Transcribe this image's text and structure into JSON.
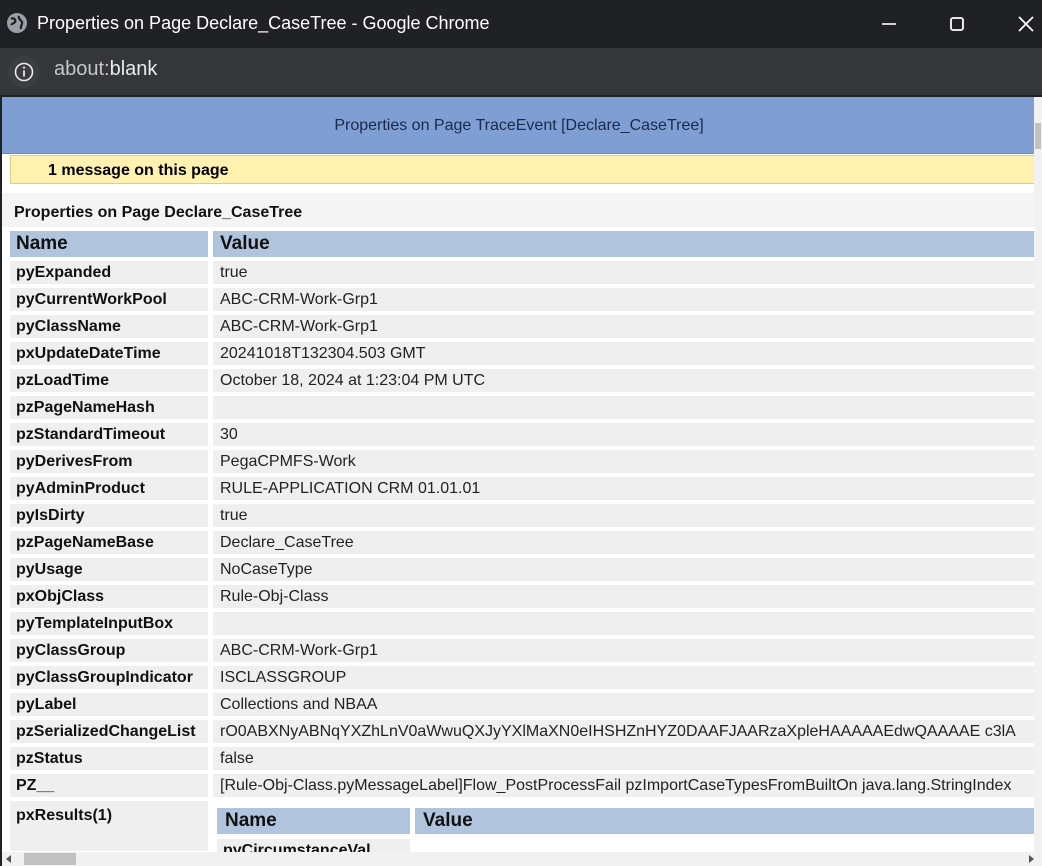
{
  "window": {
    "title": "Properties on Page Declare_CaseTree - Google Chrome"
  },
  "addressbar": {
    "url_scheme": "about:",
    "url_rest": "blank"
  },
  "page": {
    "banner_title": "Properties on Page TraceEvent [Declare_CaseTree]",
    "message": "1 message on this page",
    "section_title": "Properties on Page Declare_CaseTree",
    "headers": {
      "name": "Name",
      "value": "Value"
    },
    "rows": [
      {
        "name": "pyExpanded",
        "value": "true"
      },
      {
        "name": "pyCurrentWorkPool",
        "value": "ABC-CRM-Work-Grp1"
      },
      {
        "name": "pyClassName",
        "value": "ABC-CRM-Work-Grp1"
      },
      {
        "name": "pxUpdateDateTime",
        "value": "20241018T132304.503 GMT"
      },
      {
        "name": "pzLoadTime",
        "value": "October 18, 2024 at 1:23:04 PM UTC"
      },
      {
        "name": "pzPageNameHash",
        "value": ""
      },
      {
        "name": "pzStandardTimeout",
        "value": "30"
      },
      {
        "name": "pyDerivesFrom",
        "value": "PegaCPMFS-Work"
      },
      {
        "name": "pyAdminProduct",
        "value": "RULE-APPLICATION CRM 01.01.01"
      },
      {
        "name": "pyIsDirty",
        "value": "true"
      },
      {
        "name": "pzPageNameBase",
        "value": "Declare_CaseTree"
      },
      {
        "name": "pyUsage",
        "value": "NoCaseType"
      },
      {
        "name": "pxObjClass",
        "value": "Rule-Obj-Class"
      },
      {
        "name": "pyTemplateInputBox",
        "value": ""
      },
      {
        "name": "pyClassGroup",
        "value": "ABC-CRM-Work-Grp1"
      },
      {
        "name": "pyClassGroupIndicator",
        "value": "ISCLASSGROUP"
      },
      {
        "name": "pyLabel",
        "value": "Collections and NBAA"
      },
      {
        "name": "pzSerializedChangeList",
        "value": "rO0ABXNyABNqYXZhLnV0aWwuQXJyYXlMaXN0eIHSHZnHYZ0DAAFJAARzaXpleHAAAAAEdwQAAAAE c3lA"
      },
      {
        "name": "pzStatus",
        "value": "false"
      },
      {
        "name": "PZ__",
        "value": " [Rule-Obj-Class.pyMessageLabel]Flow_PostProcessFail pzImportCaseTypesFromBuiltOn java.lang.StringIndex"
      }
    ],
    "results_label": "pxResults(1)",
    "nested": {
      "headers": {
        "name": "Name",
        "value": "Value"
      },
      "first_row_name": "pyCircumstanceVal"
    }
  }
}
